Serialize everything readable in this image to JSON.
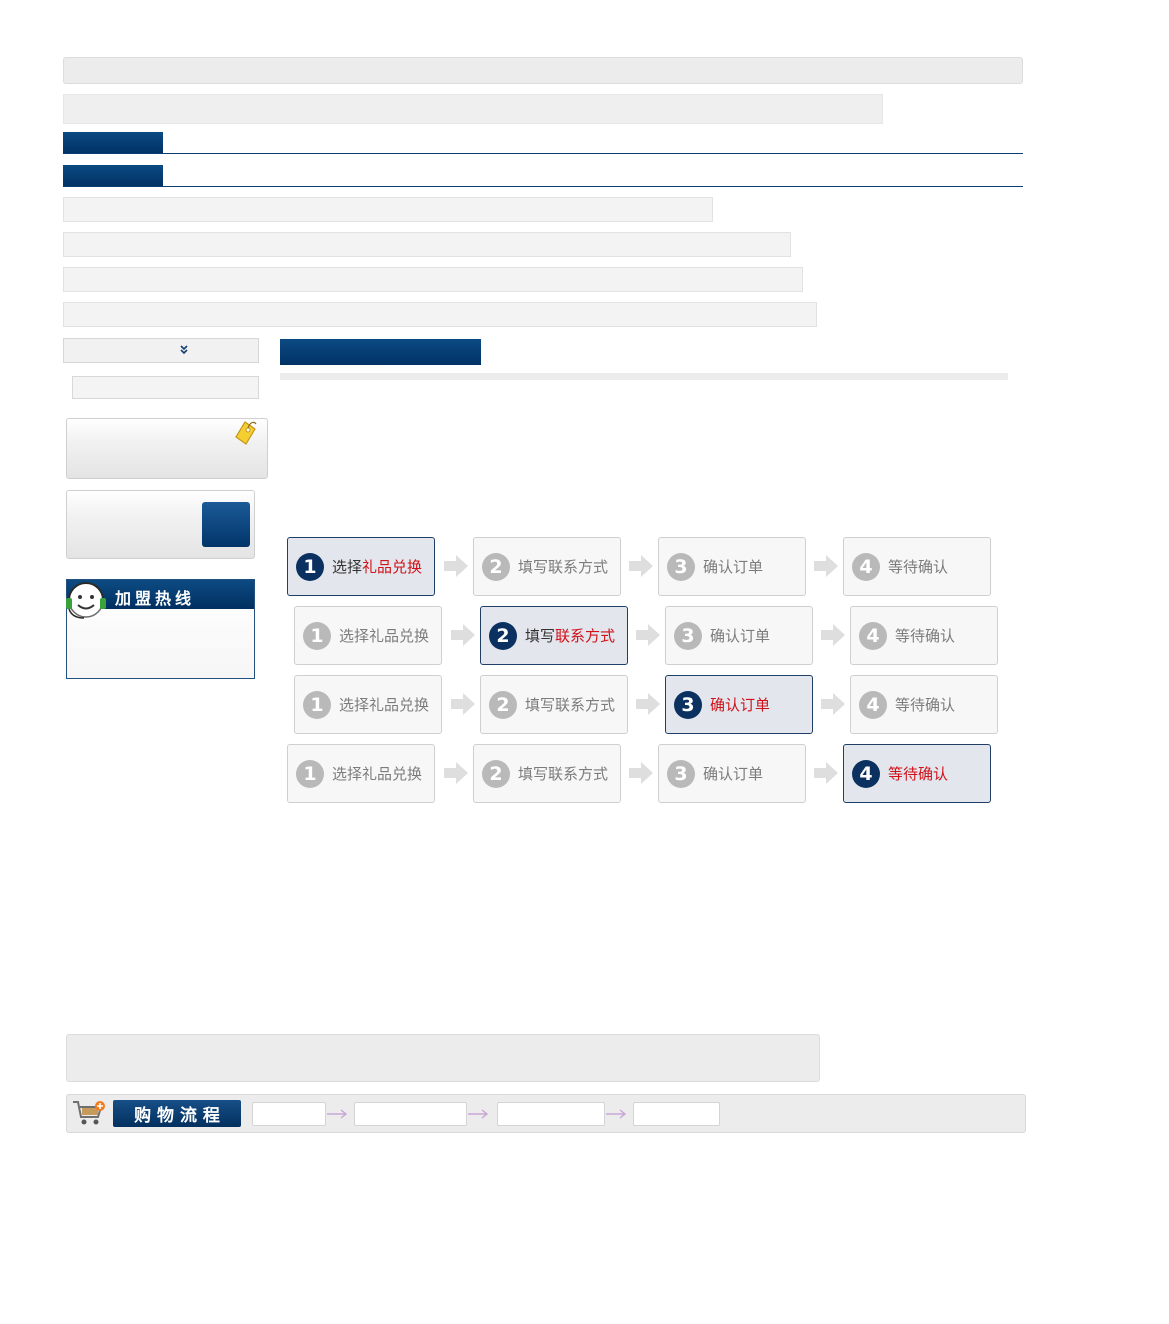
{
  "sidebar": {
    "hotline_title": "加盟热线"
  },
  "steps": [
    {
      "row": 1,
      "items": [
        {
          "num": "1",
          "plain": "选择",
          "highlight": "礼品兑换",
          "active": true
        },
        {
          "num": "2",
          "plain": "填写联系方式",
          "highlight": "",
          "active": false
        },
        {
          "num": "3",
          "plain": "确认订单",
          "highlight": "",
          "active": false
        },
        {
          "num": "4",
          "plain": "等待确认",
          "highlight": "",
          "active": false
        }
      ]
    },
    {
      "row": 2,
      "items": [
        {
          "num": "1",
          "plain": "选择礼品兑换",
          "highlight": "",
          "active": false
        },
        {
          "num": "2",
          "plain": "填写",
          "highlight": "联系方式",
          "active": true
        },
        {
          "num": "3",
          "plain": "确认订单",
          "highlight": "",
          "active": false
        },
        {
          "num": "4",
          "plain": "等待确认",
          "highlight": "",
          "active": false
        }
      ]
    },
    {
      "row": 3,
      "items": [
        {
          "num": "1",
          "plain": "选择礼品兑换",
          "highlight": "",
          "active": false
        },
        {
          "num": "2",
          "plain": "填写联系方式",
          "highlight": "",
          "active": false
        },
        {
          "num": "3",
          "plain": "",
          "highlight": "确认订单",
          "active": true
        },
        {
          "num": "4",
          "plain": "等待确认",
          "highlight": "",
          "active": false
        }
      ]
    },
    {
      "row": 4,
      "items": [
        {
          "num": "1",
          "plain": "选择礼品兑换",
          "highlight": "",
          "active": false
        },
        {
          "num": "2",
          "plain": "填写联系方式",
          "highlight": "",
          "active": false
        },
        {
          "num": "3",
          "plain": "确认订单",
          "highlight": "",
          "active": false
        },
        {
          "num": "4",
          "plain": "",
          "highlight": "等待确认",
          "active": true
        }
      ]
    }
  ],
  "shopping_flow": {
    "title": "购 物 流 程"
  },
  "colors": {
    "navy": "#013266",
    "highlight_red": "#d0121a",
    "inactive_number": "#b9b9b9"
  }
}
